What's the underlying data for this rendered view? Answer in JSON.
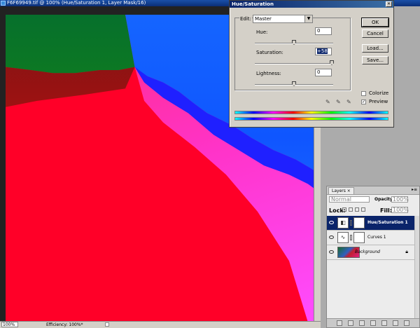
{
  "document": {
    "title": "F6F69949.tif @ 100% (Hue/Saturation 1, Layer Mask/16)",
    "zoom": "100%",
    "efficiency": "Efficiency: 100%*"
  },
  "dialog": {
    "title": "Hue/Saturation",
    "edit_label": "Edit:",
    "edit_value": "Master",
    "hue_label": "Hue:",
    "hue_value": "0",
    "saturation_label": "Saturation:",
    "saturation_value": "+58",
    "lightness_label": "Lightness:",
    "lightness_value": "0",
    "buttons": {
      "ok": "OK",
      "cancel": "Cancel",
      "load": "Load...",
      "save": "Save..."
    },
    "colorize_label": "Colorize",
    "colorize_checked": false,
    "preview_label": "Preview",
    "preview_checked": true,
    "close_glyph": "✕",
    "check_glyph": "✓"
  },
  "layers": {
    "tab_label": "Layers ×",
    "menu_glyph": "▸≡",
    "blend_mode": "Normal",
    "opacity_label": "Opacity:",
    "opacity_value": "100%",
    "lock_label": "Lock:",
    "fill_label": "Fill:",
    "fill_value": "100%",
    "items": [
      {
        "name": "Hue/Saturation 1",
        "selected": true,
        "icon": "hue-saturation-adjustment-icon"
      },
      {
        "name": "Curves 1",
        "selected": false,
        "icon": "curves-adjustment-icon"
      },
      {
        "name": "Background",
        "selected": false,
        "icon": "background-thumbnail",
        "locked": true
      }
    ],
    "lock_glyph": "🔒",
    "footer_icons": [
      "link-icon",
      "fx-icon",
      "mask-icon",
      "adjustment-icon",
      "group-icon",
      "new-layer-icon",
      "trash-icon"
    ]
  },
  "colors": {
    "selection": "#0a246a",
    "dialog_bg": "#d4d0c8"
  }
}
